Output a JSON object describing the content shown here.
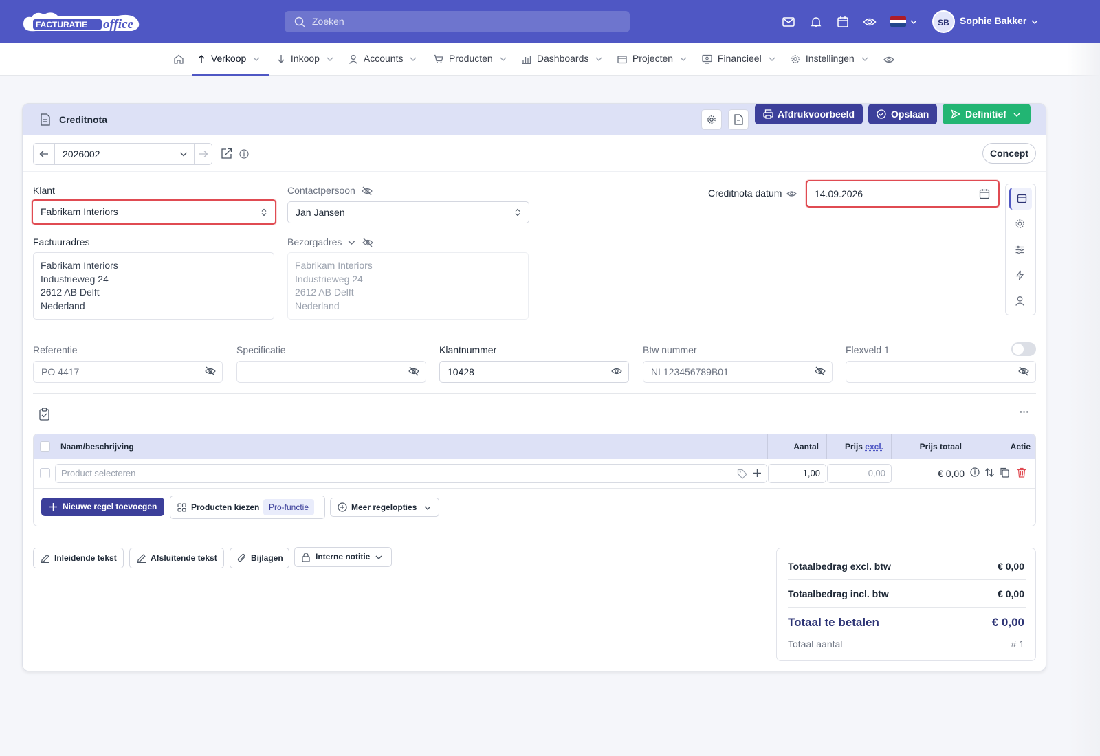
{
  "header": {
    "search_placeholder": "Zoeken",
    "user_initials": "SB",
    "user_name": "Sophie Bakker",
    "language_flag": "NL"
  },
  "nav": {
    "items": [
      {
        "label": "Verkoop",
        "active": true
      },
      {
        "label": "Inkoop"
      },
      {
        "label": "Accounts"
      },
      {
        "label": "Producten"
      },
      {
        "label": "Dashboards"
      },
      {
        "label": "Projecten"
      },
      {
        "label": "Financieel"
      },
      {
        "label": "Instellingen"
      }
    ]
  },
  "document": {
    "title": "Creditnota",
    "number": "2026002",
    "status": "Concept",
    "buttons": {
      "preview": "Afdrukvoorbeeld",
      "save": "Opslaan",
      "final": "Definitief"
    }
  },
  "form": {
    "customer_label": "Klant",
    "customer_value": "Fabrikam Interiors",
    "contact_label": "Contactpersoon",
    "contact_value": "Jan Jansen",
    "date_label": "Creditnota datum",
    "date_value": "14.09.2026",
    "billing_label": "Factuuradres",
    "billing_lines": [
      "Fabrikam Interiors",
      "Industrieweg 24",
      "2612 AB Delft",
      "Nederland"
    ],
    "shipping_label": "Bezorgadres",
    "shipping_lines": [
      "Fabrikam Interiors",
      "Industrieweg 24",
      "2612 AB Delft",
      "Nederland"
    ],
    "fields": [
      {
        "label": "Referentie",
        "value": "PO 4417"
      },
      {
        "label": "Specificatie",
        "value": ""
      },
      {
        "label": "Klantnummer",
        "value": "10428"
      },
      {
        "label": "Btw nummer",
        "value": "NL123456789B01"
      },
      {
        "label": "Flexveld 1",
        "value": ""
      }
    ]
  },
  "table": {
    "headers": {
      "name": "Naam/beschrijving",
      "qty": "Aantal",
      "price_prefix": "Prijs",
      "price_suffix": "excl.",
      "total": "Prijs totaal",
      "action": "Actie"
    },
    "row": {
      "placeholder": "Product selecteren",
      "qty": "1,00",
      "price": "0,00",
      "total": "€ 0,00"
    },
    "more": "···"
  },
  "actions": {
    "add_line": "Nieuwe regel toevoegen",
    "choose_products": "Producten kiezen",
    "pro_badge": "Pro-functie",
    "more_options": "Meer regelopties"
  },
  "footer_buttons": {
    "intro": "Inleidende tekst",
    "closing": "Afsluitende tekst",
    "attachments": "Bijlagen",
    "internal_note": "Interne notitie"
  },
  "totals": {
    "excl_label": "Totaalbedrag excl. btw",
    "excl_value": "€ 0,00",
    "incl_label": "Totaalbedrag incl. btw",
    "incl_value": "€ 0,00",
    "pay_label": "Totaal te betalen",
    "pay_value": "€ 0,00",
    "count_label": "Totaal aantal",
    "count_value": "# 1"
  },
  "colors": {
    "brand": "#4f57c4",
    "primary_button": "#3c3f9a",
    "success": "#22b573",
    "danger": "#e04b52"
  }
}
